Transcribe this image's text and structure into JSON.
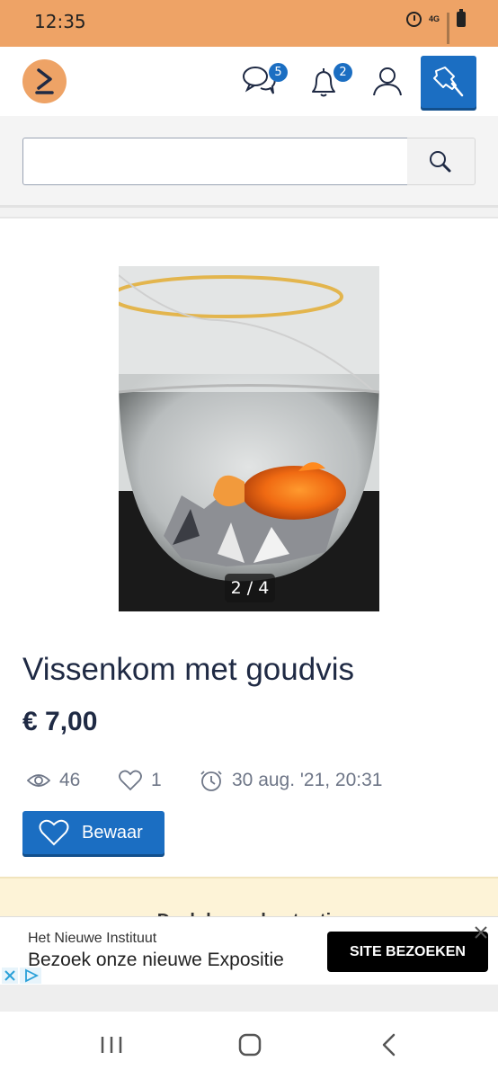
{
  "status_bar": {
    "time": "12:35",
    "network": "4G"
  },
  "header": {
    "messages_badge": "5",
    "notifications_badge": "2"
  },
  "search": {
    "value": "",
    "placeholder": ""
  },
  "listing": {
    "photo_counter": "2 / 4",
    "title": "Vissenkom met goudvis",
    "price": "€ 7,00",
    "views": "46",
    "favorites": "1",
    "date": "30 aug. '21, 20:31",
    "save_label": "Bewaar"
  },
  "notice": {
    "text": "Deel deze advertentie"
  },
  "ad": {
    "advertiser": "Het Nieuwe Instituut",
    "headline": "Bezoek onze nieuwe Expositie",
    "cta": "SITE BEZOEKEN"
  },
  "colors": {
    "brand_orange": "#eea366",
    "primary_blue": "#1b6ec2",
    "text_dark": "#1f2a44",
    "notice_yellow": "#fdf3d7"
  },
  "icons": [
    "alarm-icon",
    "battery-icon",
    "logo-icon",
    "chat-icon",
    "bell-icon",
    "user-icon",
    "pin-icon",
    "search-icon",
    "eye-icon",
    "heart-icon",
    "clock-icon",
    "close-icon",
    "adchoices-icon",
    "recent-apps-icon",
    "home-icon",
    "back-icon"
  ]
}
